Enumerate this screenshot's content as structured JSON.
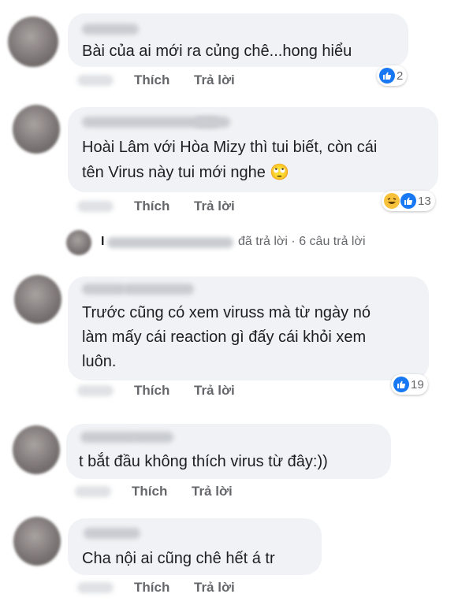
{
  "comments": [
    {
      "text_lines": [
        "Bài của ai mới ra củng chê...hong hiểu"
      ],
      "like_label": "Thích",
      "reply_label": "Trả lời",
      "reaction_count": "2",
      "reactions": [
        "like"
      ]
    },
    {
      "text_lines": [
        "Hoài Lâm với Hòa Mizy thì tui biết, còn cái",
        "tên Virus này tui mới nghe 🙄"
      ],
      "like_label": "Thích",
      "reply_label": "Trả lời",
      "reaction_count": "13",
      "reactions": [
        "haha",
        "like"
      ]
    },
    {
      "text_lines": [
        "Trước cũng có xem viruss mà từ ngày nó",
        "làm mấy cái reaction gì đấy cái khỏi xem",
        "luôn."
      ],
      "like_label": "Thích",
      "reply_label": "Trả lời",
      "reaction_count": "19",
      "reactions": [
        "like"
      ]
    },
    {
      "text_lines": [
        "t bắt đầu không thích virus từ đây:))"
      ],
      "like_label": "Thích",
      "reply_label": "Trả lời"
    },
    {
      "text_lines": [
        "Cha nội ai cũng chê hết á tr"
      ],
      "like_label": "Thích",
      "reply_label": "Trả lời"
    }
  ],
  "replies_summary": {
    "action": "đã trả lời",
    "separator": "·",
    "count_text": "6 câu trả lời"
  },
  "colors": {
    "bubble": "#f0f2f5",
    "action_text": "#65676b",
    "like_blue": "#1877f2"
  }
}
